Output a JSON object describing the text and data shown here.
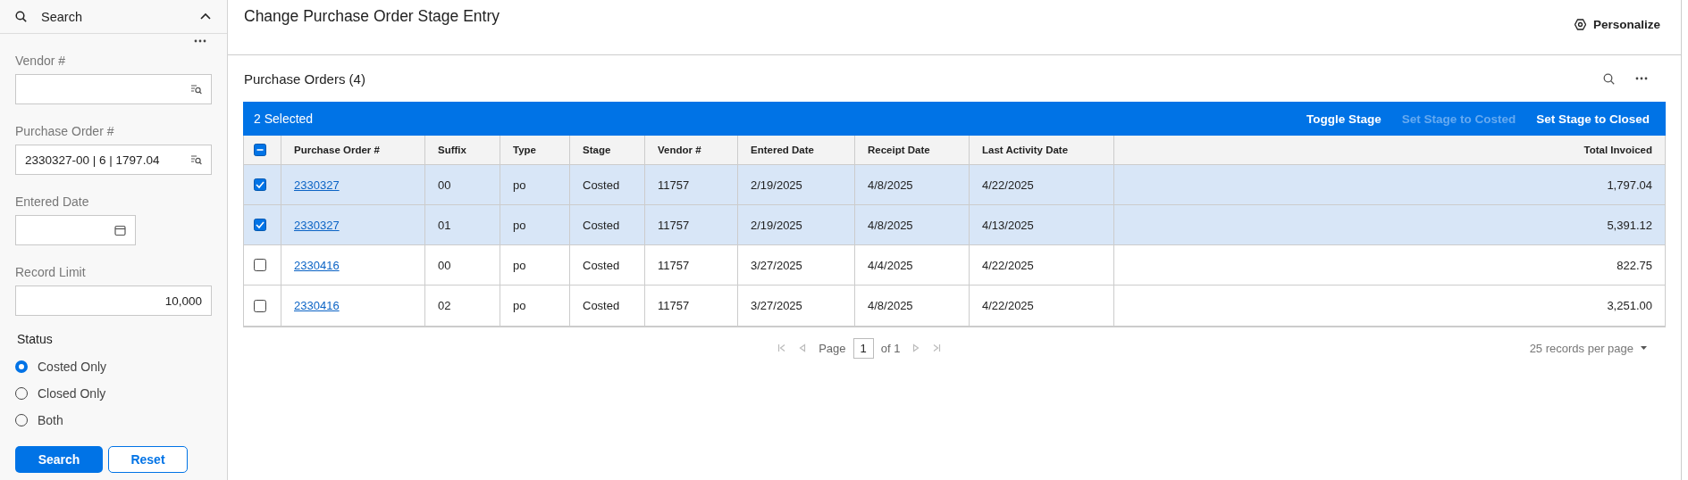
{
  "search_panel": {
    "title": "Search",
    "expanded": true,
    "fields": [
      {
        "kind": "lookup",
        "label": "Vendor #"
      },
      {
        "kind": "lookup",
        "label": "Purchase Order #",
        "value": "2330327-00 | 6 | 1797.04"
      },
      {
        "kind": "date",
        "label": "Entered Date"
      },
      {
        "kind": "number",
        "label": "Record Limit",
        "value": "10,000"
      }
    ],
    "status": {
      "label": "Status",
      "options": [
        {
          "label": "Costed Only",
          "selected": true
        },
        {
          "label": "Closed Only",
          "selected": false
        },
        {
          "label": "Both",
          "selected": false
        }
      ]
    },
    "buttons": [
      {
        "label": "Search",
        "kind": "primary"
      },
      {
        "label": "Reset",
        "kind": "secondary"
      }
    ]
  },
  "page": {
    "title": "Change Purchase Order Stage Entry",
    "personalize": "Personalize"
  },
  "grid": {
    "title": "Purchase Orders (4)",
    "selection_bar": {
      "count": "2 Selected",
      "actions": [
        {
          "label": "Toggle Stage",
          "disabled": false
        },
        {
          "label": "Set Stage to Costed",
          "disabled": true
        },
        {
          "label": "Set Stage to Closed",
          "disabled": false
        }
      ]
    },
    "select_all": {
      "indeterminate": true
    },
    "columns": [
      {
        "label": "Purchase Order #",
        "kind": "link"
      },
      {
        "label": "Suffix",
        "kind": "text"
      },
      {
        "label": "Type",
        "kind": "text"
      },
      {
        "label": "Stage",
        "kind": "text"
      },
      {
        "label": "Vendor #",
        "kind": "text"
      },
      {
        "label": "Entered Date",
        "kind": "text"
      },
      {
        "label": "Receipt Date",
        "kind": "text"
      },
      {
        "label": "Last Activity Date",
        "kind": "text"
      },
      {
        "label": "Total Invoiced",
        "kind": "amount"
      }
    ],
    "rows": [
      {
        "selected": true,
        "cells": [
          "2330327",
          "00",
          "po",
          "Costed",
          "11757",
          "2/19/2025",
          "4/8/2025",
          "4/22/2025",
          "1,797.04"
        ]
      },
      {
        "selected": true,
        "cells": [
          "2330327",
          "01",
          "po",
          "Costed",
          "11757",
          "2/19/2025",
          "4/8/2025",
          "4/13/2025",
          "5,391.12"
        ]
      },
      {
        "selected": false,
        "cells": [
          "2330416",
          "00",
          "po",
          "Costed",
          "11757",
          "3/27/2025",
          "4/4/2025",
          "4/22/2025",
          "822.75"
        ]
      },
      {
        "selected": false,
        "cells": [
          "2330416",
          "02",
          "po",
          "Costed",
          "11757",
          "3/27/2025",
          "4/8/2025",
          "4/22/2025",
          "3,251.00"
        ]
      }
    ],
    "pagination": {
      "page_label": "Page",
      "page": "1",
      "of": "of 1",
      "per_page": "25 records per page"
    }
  }
}
